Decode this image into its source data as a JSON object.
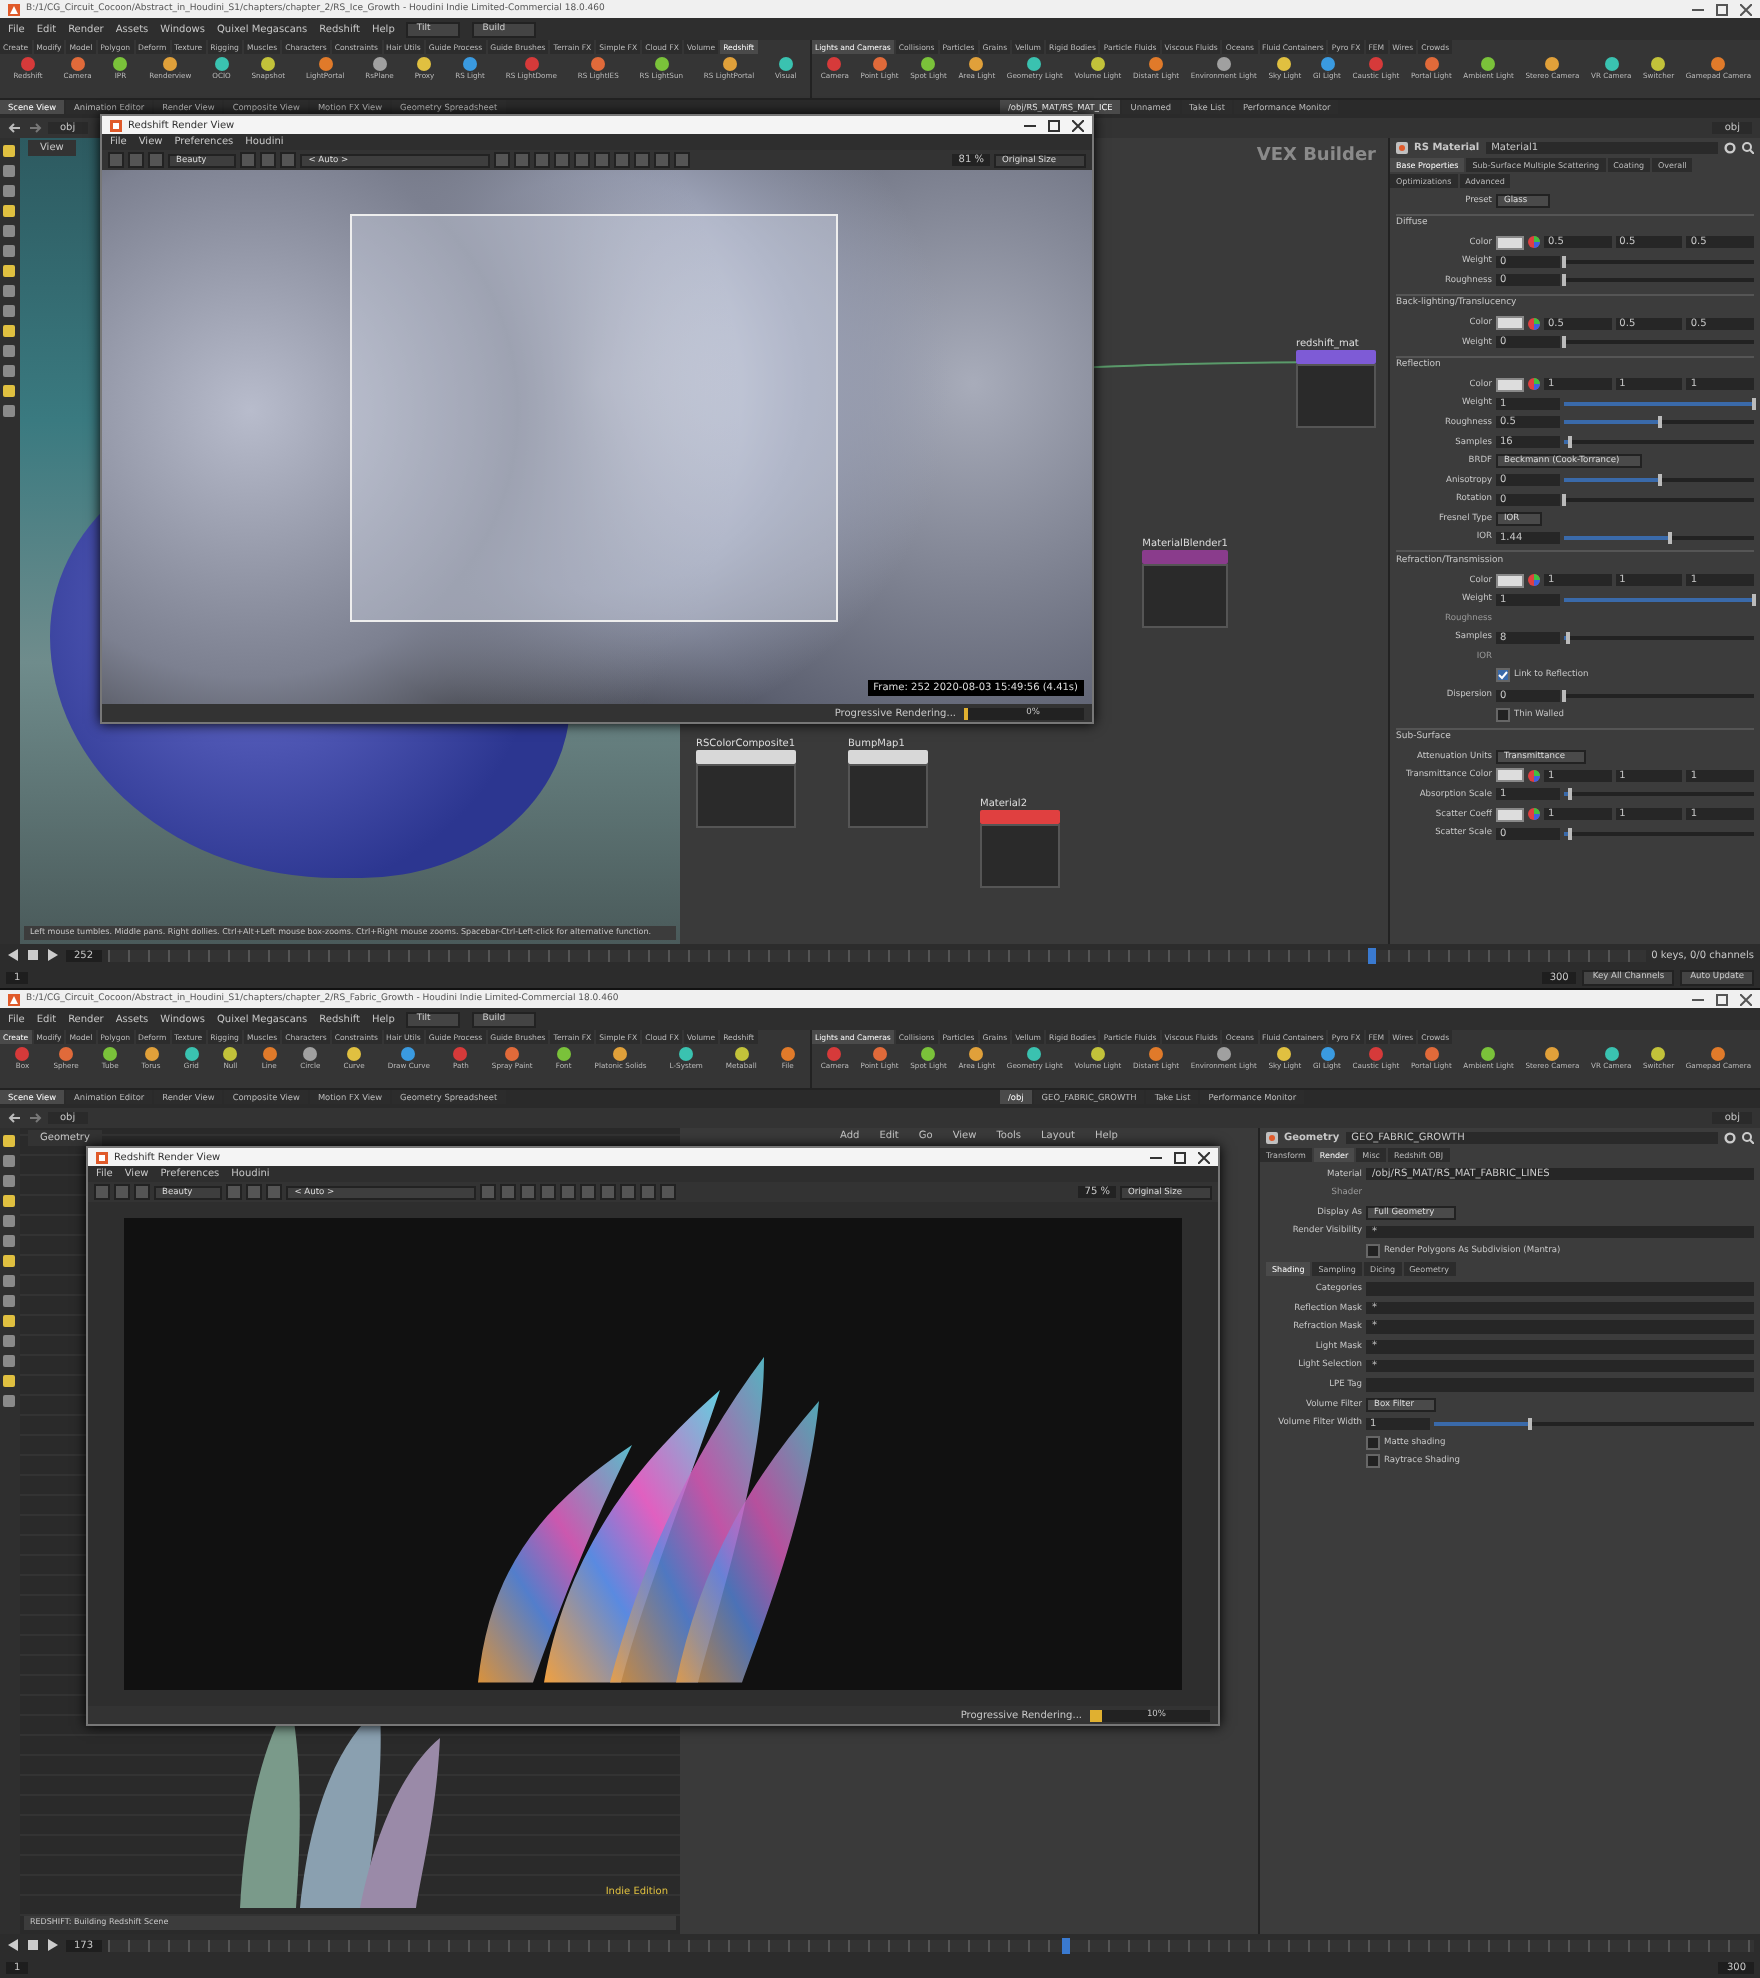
{
  "screens": [
    {
      "title_bar": "B:/1/CG_Circuit_Cocoon/Abstract_in_Houdini_S1/chapters/chapter_2/RS_Ice_Growth - Houdini Indie Limited-Commercial 18.0.460",
      "menu": [
        "File",
        "Edit",
        "Render",
        "Assets",
        "Windows",
        "Quixel Megascans",
        "Redshift",
        "Help"
      ],
      "desktops": [
        "Tilt",
        "Build"
      ],
      "shelf_tabs": [
        {
          "label": "Create",
          "selected": false
        },
        {
          "label": "Modify",
          "selected": false
        },
        {
          "label": "Model",
          "selected": false
        },
        {
          "label": "Polygon",
          "selected": false
        },
        {
          "label": "Deform",
          "selected": false
        },
        {
          "label": "Texture",
          "selected": false
        },
        {
          "label": "Rigging",
          "selected": false
        },
        {
          "label": "Muscles",
          "selected": false
        },
        {
          "label": "Characters",
          "selected": false
        },
        {
          "label": "Constraints",
          "selected": false
        },
        {
          "label": "Hair Utils",
          "selected": false
        },
        {
          "label": "Guide Process",
          "selected": false
        },
        {
          "label": "Guide Brushes",
          "selected": false
        },
        {
          "label": "Terrain FX",
          "selected": false
        },
        {
          "label": "Simple FX",
          "selected": false
        },
        {
          "label": "Cloud FX",
          "selected": false
        },
        {
          "label": "Volume",
          "selected": false
        },
        {
          "label": "Redshift",
          "selected": true
        }
      ],
      "shelf_tools": [
        "Redshift",
        "Camera",
        "IPR",
        "Renderview",
        "OCIO",
        "Snapshot",
        "LightPortal",
        "RsPlane",
        "Proxy",
        "RS Light",
        "RS LightDome",
        "RS LightIES",
        "RS LightSun",
        "RS LightPortal",
        "Visual"
      ],
      "right_shelf_tabs": [
        {
          "label": "Lights and Cameras",
          "selected": true
        },
        {
          "label": "Collisions",
          "selected": false
        },
        {
          "label": "Particles",
          "selected": false
        },
        {
          "label": "Grains",
          "selected": false
        },
        {
          "label": "Vellum",
          "selected": false
        },
        {
          "label": "Rigid Bodies",
          "selected": false
        },
        {
          "label": "Particle Fluids",
          "selected": false
        },
        {
          "label": "Viscous Fluids",
          "selected": false
        },
        {
          "label": "Oceans",
          "selected": false
        },
        {
          "label": "Fluid Containers",
          "selected": false
        },
        {
          "label": "Pyro FX",
          "selected": false
        },
        {
          "label": "FEM",
          "selected": false
        },
        {
          "label": "Wires",
          "selected": false
        },
        {
          "label": "Crowds",
          "selected": false
        }
      ],
      "right_shelf_tools": [
        "Camera",
        "Point Light",
        "Spot Light",
        "Area Light",
        "Geometry Light",
        "Volume Light",
        "Distant Light",
        "Environment Light",
        "Sky Light",
        "GI Light",
        "Caustic Light",
        "Portal Light",
        "Ambient Light",
        "Stereo Camera",
        "VR Camera",
        "Switcher",
        "Gamepad Camera"
      ],
      "pane_tabs": [
        {
          "label": "Scene View",
          "selected": true
        },
        {
          "label": "Animation Editor",
          "selected": false
        },
        {
          "label": "Render View",
          "selected": false
        },
        {
          "label": "Composite View",
          "selected": false
        },
        {
          "label": "Motion FX View",
          "selected": false
        },
        {
          "label": "Geometry Spreadsheet",
          "selected": false
        }
      ],
      "network_tabs": [
        {
          "label": "/obj/RS_MAT/RS_MAT_ICE",
          "selected": true
        },
        {
          "label": "Unnamed",
          "selected": false
        },
        {
          "label": "Take List",
          "selected": false
        },
        {
          "label": "Performance Monitor",
          "selected": false
        }
      ],
      "path": "obj",
      "network_path": "obj",
      "viewport": {
        "kind": "ice",
        "label": "View",
        "status": "Left mouse tumbles. Middle pans. Right dollies. Ctrl+Alt+Left mouse box-zooms. Ctrl+Right mouse zooms. Spacebar-Ctrl-Left-click for alternative function."
      },
      "render_view": {
        "title": "Redshift Render View",
        "menu": [
          "File",
          "View",
          "Preferences",
          "Houdini"
        ],
        "aov": "Beauty",
        "camera": "< Auto >",
        "zoom": "81 %",
        "size": "Original Size",
        "kind": "ice",
        "region": true,
        "info": "Frame: 252 2020-08-03 15:49:56 (4.41s)",
        "progress_label": "Progressive Rendering...",
        "progress": "0%",
        "level": 0
      },
      "network": {
        "label": "VEX Builder",
        "nodes": [
          {
            "name": "redshift_mat",
            "color": "#7e5bd6"
          },
          {
            "name": "MaterialBlender1",
            "color": "#8a3c8c"
          },
          {
            "name": "RSColorComposite1",
            "color": "#d8d8d8"
          },
          {
            "name": "BumpMap1",
            "color": "#d8d8d8"
          },
          {
            "name": "Material2",
            "color": "#e04040"
          }
        ]
      },
      "parameters": {
        "type": "RS Material",
        "name": "Material1",
        "tabs": [
          {
            "label": "Base Properties",
            "selected": true
          },
          {
            "label": "Sub-Surface Multiple Scattering",
            "selected": false
          },
          {
            "label": "Coating",
            "selected": false
          },
          {
            "label": "Overall",
            "selected": false
          },
          {
            "label": "Optimizations",
            "selected": false
          },
          {
            "label": "Advanced",
            "selected": false
          }
        ],
        "rows": [
          {
            "kind": "menu",
            "label": "Preset",
            "value": "Glass"
          },
          {
            "kind": "section",
            "label": "Diffuse"
          },
          {
            "kind": "color",
            "label": "Color",
            "values": [
              "0.5",
              "0.5",
              "0.5"
            ]
          },
          {
            "kind": "slider",
            "label": "Weight",
            "value": "0",
            "level": 0
          },
          {
            "kind": "slider",
            "label": "Roughness",
            "value": "0",
            "level": 0
          },
          {
            "kind": "section",
            "label": "Back-lighting/Translucency"
          },
          {
            "kind": "color",
            "label": "Color",
            "values": [
              "0.5",
              "0.5",
              "0.5"
            ]
          },
          {
            "kind": "slider",
            "label": "Weight",
            "value": "0",
            "level": 0
          },
          {
            "kind": "section",
            "label": "Reflection"
          },
          {
            "kind": "color",
            "label": "Color",
            "values": [
              "1",
              "1",
              "1"
            ]
          },
          {
            "kind": "slider",
            "label": "Weight",
            "value": "1",
            "level": 1
          },
          {
            "kind": "slider",
            "label": "Roughness",
            "value": "0.5",
            "level": 0.5
          },
          {
            "kind": "slider",
            "label": "Samples",
            "value": "16",
            "level": 0.03
          },
          {
            "kind": "menu",
            "label": "BRDF",
            "value": "Beckmann (Cook-Torrance)"
          },
          {
            "kind": "slider",
            "label": "Anisotropy",
            "value": "0",
            "level": 0.5
          },
          {
            "kind": "slider",
            "label": "Rotation",
            "value": "0",
            "level": 0
          },
          {
            "kind": "menu",
            "label": "Fresnel Type",
            "value": "IOR"
          },
          {
            "kind": "slider",
            "label": "IOR",
            "value": "1.44",
            "level": 0.56
          },
          {
            "kind": "section",
            "label": "Refraction/Transmission"
          },
          {
            "kind": "color",
            "label": "Color",
            "values": [
              "1",
              "1",
              "1"
            ]
          },
          {
            "kind": "slider",
            "label": "Weight",
            "value": "1",
            "level": 1
          },
          {
            "kind": "inactive",
            "label": "Roughness"
          },
          {
            "kind": "slider",
            "label": "Samples",
            "value": "8",
            "level": 0.02
          },
          {
            "kind": "inactive",
            "label": "IOR"
          },
          {
            "kind": "checkbox",
            "label": "Link to Reflection",
            "checked": true
          },
          {
            "kind": "slider",
            "label": "Dispersion",
            "value": "0",
            "level": 0
          },
          {
            "kind": "checkbox",
            "label": "Thin Walled",
            "checked": false
          },
          {
            "kind": "section",
            "label": "Sub-Surface"
          },
          {
            "kind": "menu",
            "label": "Attenuation Units",
            "value": "Transmittance"
          },
          {
            "kind": "color",
            "label": "Transmittance Color",
            "values": [
              "1",
              "1",
              "1"
            ]
          },
          {
            "kind": "slider",
            "label": "Absorption Scale",
            "value": "1",
            "level": 0.03
          },
          {
            "kind": "color",
            "label": "Scatter Coeff",
            "values": [
              "1",
              "1",
              "1"
            ]
          },
          {
            "kind": "slider",
            "label": "Scatter Scale",
            "value": "0",
            "level": 0.03
          }
        ]
      },
      "timeline": {
        "frame": "252",
        "start": "1",
        "end": "300",
        "keys": "0 keys, 0/0 channels",
        "key_button": "Key All Channels",
        "update": "Auto Update",
        "level": 0.82
      }
    },
    {
      "title_bar": "B:/1/CG_Circuit_Cocoon/Abstract_in_Houdini_S1/chapters/chapter_2/RS_Fabric_Growth - Houdini Indie Limited-Commercial 18.0.460",
      "menu": [
        "File",
        "Edit",
        "Render",
        "Assets",
        "Windows",
        "Quixel Megascans",
        "Redshift",
        "Help"
      ],
      "desktops": [
        "Tilt",
        "Build"
      ],
      "shelf_tabs": [
        {
          "label": "Create",
          "selected": true
        },
        {
          "label": "Modify",
          "selected": false
        },
        {
          "label": "Model",
          "selected": false
        },
        {
          "label": "Polygon",
          "selected": false
        },
        {
          "label": "Deform",
          "selected": false
        },
        {
          "label": "Texture",
          "selected": false
        },
        {
          "label": "Rigging",
          "selected": false
        },
        {
          "label": "Muscles",
          "selected": false
        },
        {
          "label": "Characters",
          "selected": false
        },
        {
          "label": "Constraints",
          "selected": false
        },
        {
          "label": "Hair Utils",
          "selected": false
        },
        {
          "label": "Guide Process",
          "selected": false
        },
        {
          "label": "Guide Brushes",
          "selected": false
        },
        {
          "label": "Terrain FX",
          "selected": false
        },
        {
          "label": "Simple FX",
          "selected": false
        },
        {
          "label": "Cloud FX",
          "selected": false
        },
        {
          "label": "Volume",
          "selected": false
        },
        {
          "label": "Redshift",
          "selected": false
        }
      ],
      "shelf_tools": [
        "Box",
        "Sphere",
        "Tube",
        "Torus",
        "Grid",
        "Null",
        "Line",
        "Circle",
        "Curve",
        "Draw Curve",
        "Path",
        "Spray Paint",
        "Font",
        "Platonic Solids",
        "L-System",
        "Metaball",
        "File"
      ],
      "right_shelf_tabs": [
        {
          "label": "Lights and Cameras",
          "selected": true
        },
        {
          "label": "Collisions",
          "selected": false
        },
        {
          "label": "Particles",
          "selected": false
        },
        {
          "label": "Grains",
          "selected": false
        },
        {
          "label": "Vellum",
          "selected": false
        },
        {
          "label": "Rigid Bodies",
          "selected": false
        },
        {
          "label": "Particle Fluids",
          "selected": false
        },
        {
          "label": "Viscous Fluids",
          "selected": false
        },
        {
          "label": "Oceans",
          "selected": false
        },
        {
          "label": "Fluid Containers",
          "selected": false
        },
        {
          "label": "Pyro FX",
          "selected": false
        },
        {
          "label": "FEM",
          "selected": false
        },
        {
          "label": "Wires",
          "selected": false
        },
        {
          "label": "Crowds",
          "selected": false
        }
      ],
      "right_shelf_tools": [
        "Camera",
        "Point Light",
        "Spot Light",
        "Area Light",
        "Geometry Light",
        "Volume Light",
        "Distant Light",
        "Environment Light",
        "Sky Light",
        "GI Light",
        "Caustic Light",
        "Portal Light",
        "Ambient Light",
        "Stereo Camera",
        "VR Camera",
        "Switcher",
        "Gamepad Camera"
      ],
      "pane_tabs": [
        {
          "label": "Scene View",
          "selected": true
        },
        {
          "label": "Animation Editor",
          "selected": false
        },
        {
          "label": "Render View",
          "selected": false
        },
        {
          "label": "Composite View",
          "selected": false
        },
        {
          "label": "Motion FX View",
          "selected": false
        },
        {
          "label": "Geometry Spreadsheet",
          "selected": false
        }
      ],
      "network_tabs": [
        {
          "label": "/obj",
          "selected": true
        },
        {
          "label": "GEO_FABRIC_GROWTH",
          "selected": false
        },
        {
          "label": "Take List",
          "selected": false
        },
        {
          "label": "Performance Monitor",
          "selected": false
        }
      ],
      "path": "obj",
      "network_path": "obj",
      "network_menu": [
        "Add",
        "Edit",
        "Go",
        "View",
        "Tools",
        "Layout",
        "Help"
      ],
      "viewport": {
        "kind": "fabric",
        "label": "Geometry",
        "status": "REDSHIFT: Building Redshift Scene",
        "badge": "Indie Edition"
      },
      "render_view": {
        "title": "Redshift Render View",
        "menu": [
          "File",
          "View",
          "Preferences",
          "Houdini"
        ],
        "aov": "Beauty",
        "camera": "< Auto >",
        "zoom": "75 %",
        "size": "Original Size",
        "kind": "fabric",
        "progress_label": "Progressive Rendering...",
        "progress": "10%",
        "level": 0.1
      },
      "parameters": {
        "type": "Geometry",
        "name": "GEO_FABRIC_GROWTH",
        "tabs": [
          {
            "label": "Transform",
            "selected": false
          },
          {
            "label": "Render",
            "selected": true
          },
          {
            "label": "Misc",
            "selected": false
          },
          {
            "label": "Redshift OBJ",
            "selected": false
          }
        ],
        "rows": [
          {
            "kind": "field",
            "label": "Material",
            "value": "/obj/RS_MAT/RS_MAT_FABRIC_LINES"
          },
          {
            "kind": "inactive",
            "label": "Shader"
          },
          {
            "kind": "menu",
            "label": "Display As",
            "value": "Full Geometry"
          },
          {
            "kind": "field",
            "label": "Render Visibility",
            "value": "*"
          },
          {
            "kind": "checkbox",
            "label": "Render Polygons As Subdivision (Mantra)",
            "checked": false
          },
          {
            "kind": "subtabs",
            "items": [
              {
                "label": "Shading",
                "selected": true
              },
              {
                "label": "Sampling",
                "selected": false
              },
              {
                "label": "Dicing",
                "selected": false
              },
              {
                "label": "Geometry",
                "selected": false
              }
            ]
          },
          {
            "kind": "field",
            "label": "Categories",
            "value": ""
          },
          {
            "kind": "field",
            "label": "Reflection Mask",
            "value": "*"
          },
          {
            "kind": "field",
            "label": "Refraction Mask",
            "value": "*"
          },
          {
            "kind": "field",
            "label": "Light Mask",
            "value": "*"
          },
          {
            "kind": "field",
            "label": "Light Selection",
            "value": "*"
          },
          {
            "kind": "field",
            "label": "LPE Tag",
            "value": ""
          },
          {
            "kind": "menu",
            "label": "Volume Filter",
            "value": "Box Filter"
          },
          {
            "kind": "slider",
            "label": "Volume Filter Width",
            "value": "1",
            "level": 0.3
          },
          {
            "kind": "checkbox",
            "label": "Matte shading",
            "checked": false
          },
          {
            "kind": "checkbox",
            "label": "Raytrace Shading",
            "checked": false
          }
        ]
      },
      "timeline": {
        "frame": "173",
        "start": "1",
        "end": "300",
        "level": 0.58
      }
    }
  ]
}
